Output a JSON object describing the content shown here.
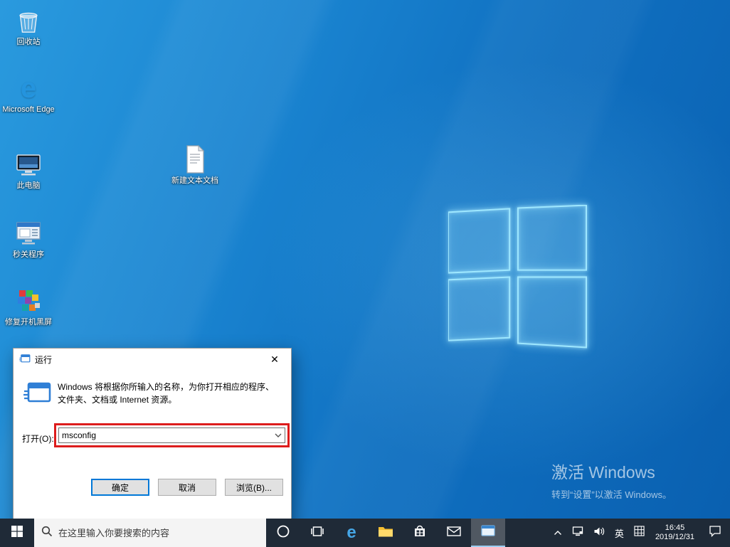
{
  "desktop": {
    "icons": [
      {
        "label": "回收站"
      },
      {
        "label": "Microsoft Edge"
      },
      {
        "label": "此电脑"
      },
      {
        "label": "秒关程序"
      },
      {
        "label": "修复开机黑屏"
      },
      {
        "label": "新建文本文档"
      }
    ],
    "activation": {
      "line1": "激活 Windows",
      "line2": "转到“设置”以激活 Windows。"
    }
  },
  "run_dialog": {
    "title": "运行",
    "close_glyph": "✕",
    "description": "Windows 将根据你所输入的名称，为你打开相应的程序、文件夹、文档或 Internet 资源。",
    "open_label": "打开(O):",
    "input_value": "msconfig",
    "buttons": {
      "ok": "确定",
      "cancel": "取消",
      "browse": "浏览(B)..."
    }
  },
  "taskbar": {
    "search_placeholder": "在这里输入你要搜索的内容",
    "tray": {
      "ime_label": "英",
      "time": "16:45",
      "date": "2019/12/31"
    }
  },
  "colors": {
    "accent": "#0078d7",
    "annotation_red": "#dd1c1c",
    "taskbar_bg": "#1f2a37"
  }
}
